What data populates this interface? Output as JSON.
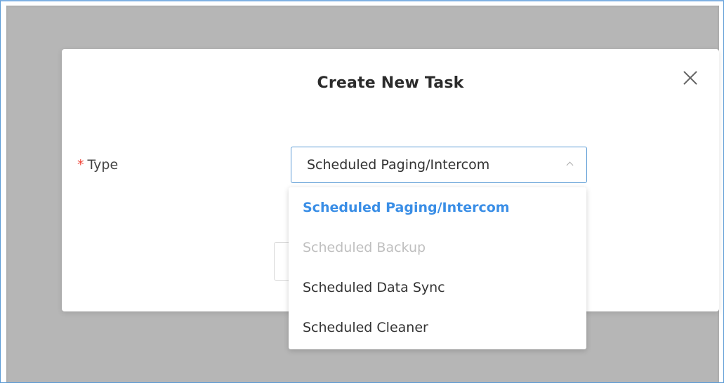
{
  "modal": {
    "title": "Create New Task",
    "close_label": "×"
  },
  "form": {
    "type_field": {
      "required_mark": "*",
      "label": "Type",
      "selected_value": "Scheduled Paging/Intercom"
    }
  },
  "dropdown": {
    "options": [
      {
        "label": "Scheduled Paging/Intercom",
        "state": "selected"
      },
      {
        "label": "Scheduled Backup",
        "state": "disabled"
      },
      {
        "label": "Scheduled Data Sync",
        "state": "normal"
      },
      {
        "label": "Scheduled Cleaner",
        "state": "normal"
      }
    ]
  },
  "colors": {
    "accent": "#3a8ee6",
    "required": "#f04134",
    "overlay": "#b6b6b6",
    "disabled_text": "#bfbfbf"
  }
}
